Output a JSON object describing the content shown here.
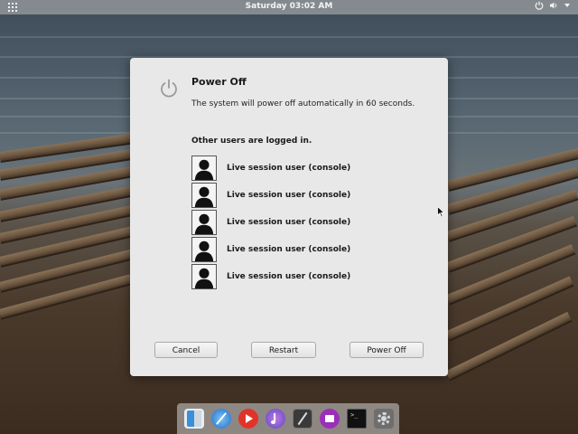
{
  "topbar": {
    "clock": "Saturday 03:02 AM",
    "apps_icon": "apps-grid-icon",
    "tray_icons": [
      "power-icon",
      "volume-icon",
      "chevron-down-icon"
    ]
  },
  "dialog": {
    "icon": "power-icon",
    "title": "Power Off",
    "message": "The system will power off automatically in 60 seconds.",
    "users_heading": "Other users are logged in.",
    "users": [
      {
        "name": "Live session user (console)",
        "avatar": "user-silhouette-icon"
      },
      {
        "name": "Live session user (console)",
        "avatar": "user-silhouette-icon"
      },
      {
        "name": "Live session user (console)",
        "avatar": "user-silhouette-icon"
      },
      {
        "name": "Live session user (console)",
        "avatar": "user-silhouette-icon"
      },
      {
        "name": "Live session user (console)",
        "avatar": "user-silhouette-icon"
      }
    ],
    "buttons": {
      "cancel": "Cancel",
      "restart": "Restart",
      "power_off": "Power Off"
    }
  },
  "dock": {
    "items": [
      {
        "icon": "files-icon",
        "color": "#3b8fd9"
      },
      {
        "icon": "browser-icon",
        "color": "#2f7fd6"
      },
      {
        "icon": "video-player-icon",
        "color": "#e0342a"
      },
      {
        "icon": "music-player-icon",
        "color": "#6a4fc9"
      },
      {
        "icon": "notes-icon",
        "color": "#3a3a3a"
      },
      {
        "icon": "app-center-icon",
        "color": "#9a2fb8"
      },
      {
        "icon": "terminal-icon",
        "color": "#111111"
      },
      {
        "icon": "settings-icon",
        "color": "#6e6e6e"
      }
    ]
  }
}
